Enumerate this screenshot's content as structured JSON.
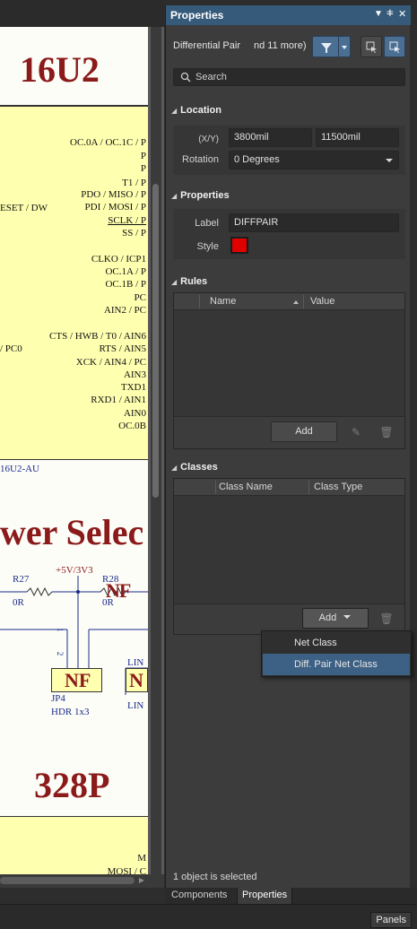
{
  "schematic": {
    "top_title": "16U2",
    "pins_right": [
      "OC.0A / OC.1C / P",
      "P",
      "P",
      "T1 / P",
      "PDO / MISO / P",
      "PDI / MOSI / P",
      "SCLK / P",
      "SS / P",
      "CLKO / ICP1",
      "OC.1A / P",
      "OC.1B / P",
      "PC",
      "AIN2 / PC",
      "CTS / HWB / T0 / AIN6",
      "RTS / AIN5",
      "XCK / AIN4 / PC",
      "AIN3",
      "TXD1",
      "RXD1 / AIN1",
      "AIN0",
      "OC.0B"
    ],
    "reset_label": "ESET / DW",
    "pc0_label": "/ PC0",
    "part_label": "16U2-AU",
    "section_title": "wer Selec",
    "r27_label": "R27",
    "r27_value": "0R",
    "supply_label": "+5V/3V3",
    "r28_label": "R28",
    "r28_value": "0R",
    "nf1": "NF",
    "nf2": "NF",
    "nf3": "N",
    "jp_pins": "1 2 3",
    "jp_label": "JP4",
    "jp_value": "HDR 1x3",
    "lin_label": "LIN",
    "lin_label2": "LIN",
    "bottom_title": "328P",
    "bottom_pin1": "M",
    "bottom_pin2": "MOSI / C"
  },
  "panel": {
    "title": "Properties",
    "filter_text": "Differential Pair",
    "filter_more": "nd 11 more)",
    "search_placeholder": "Search",
    "location": {
      "header": "Location",
      "xy_label": "(X/Y)",
      "x_value": "3800mil",
      "y_value": "11500mil",
      "rotation_label": "Rotation",
      "rotation_value": "0 Degrees"
    },
    "properties": {
      "header": "Properties",
      "label_label": "Label",
      "label_value": "DIFFPAIR",
      "style_label": "Style",
      "style_color": "#e00000"
    },
    "rules": {
      "header": "Rules",
      "col_name": "Name",
      "col_value": "Value",
      "add_label": "Add"
    },
    "classes": {
      "header": "Classes",
      "col_class_name": "Class Name",
      "col_class_type": "Class Type",
      "add_label": "Add"
    },
    "status": "1 object is selected"
  },
  "menu": {
    "items": [
      "Net Class",
      "Diff. Pair Net Class"
    ]
  },
  "tabs": [
    "Components",
    "Properties"
  ],
  "panels_button": "Panels",
  "colors": {
    "header_blue": "#365a7a",
    "selected_menu": "#3d6185",
    "schematic_red": "#8b1a1a",
    "component_yellow": "#ffffb0"
  }
}
